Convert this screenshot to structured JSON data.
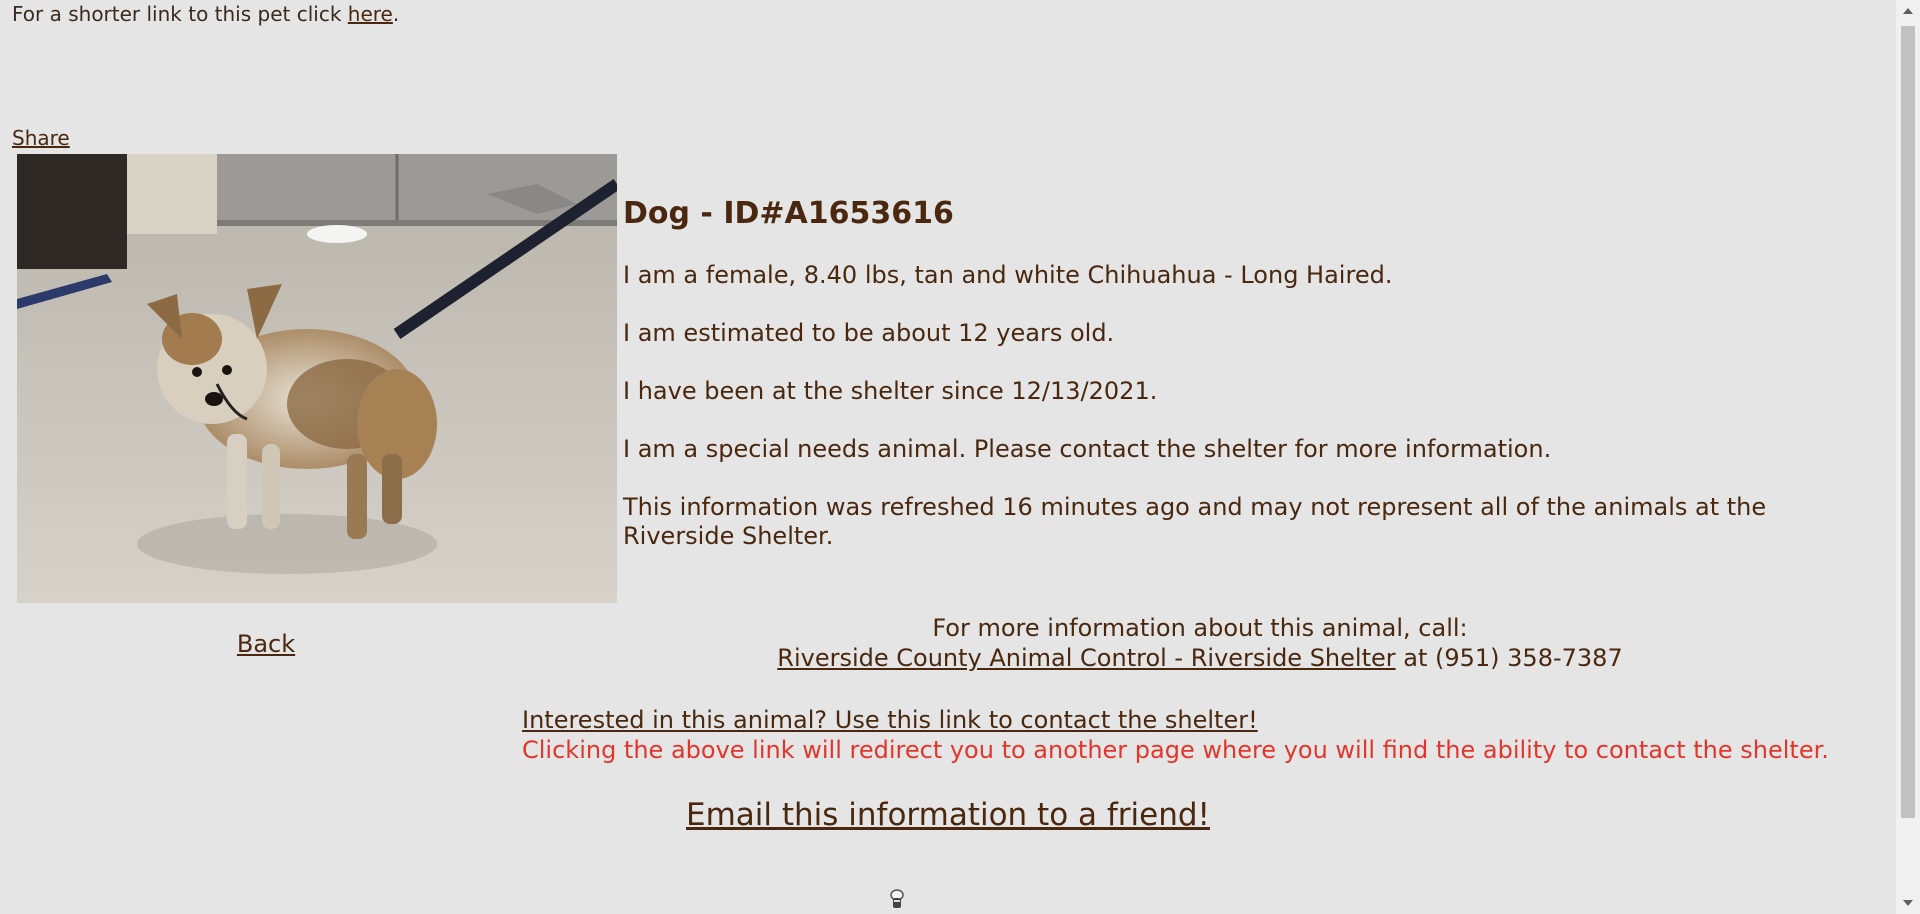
{
  "short_link": {
    "prefix": "For a shorter link to this pet click ",
    "link_text": "here",
    "suffix": "."
  },
  "share_label": "Share",
  "photo": {
    "icon": "dog-photo"
  },
  "animal": {
    "heading": "Dog - ID#A1653616",
    "description": "I am a female, 8.40 lbs, tan and white Chihuahua - Long Haired.",
    "age": "I am estimated to be about 12 years old.",
    "since": "I have been at the shelter since 12/13/2021.",
    "special_needs": "I am a special needs animal. Please contact the shelter for more information.",
    "refreshed": "This information was refreshed 16 minutes ago and may not represent all of the animals at the Riverside Shelter."
  },
  "back_label": "Back",
  "contact": {
    "intro": "For more information about this animal, call:",
    "shelter_link": "Riverside County Animal Control - Riverside Shelter",
    "phone_text": " at (951) 358-7387"
  },
  "interested_link": "Interested in this animal? Use this link to contact the shelter!",
  "redirect_note": "Clicking the above link will redirect you to another page where you will find the ability to contact the shelter.",
  "email_friend_link": "Email this information to a friend!",
  "colors": {
    "background": "#e5e5e5",
    "text": "#4a2810",
    "warning": "#e0362c"
  }
}
